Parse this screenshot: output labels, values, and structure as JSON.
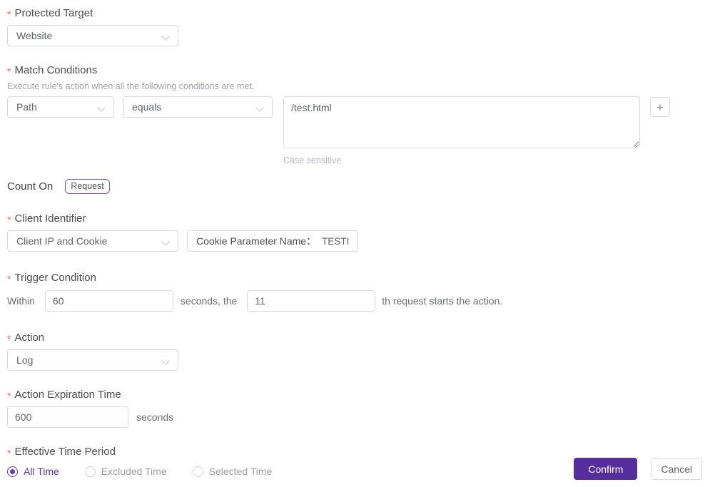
{
  "colors": {
    "accent_purple": "#562d9c",
    "radio_purple": "#6a3ac2",
    "required_red": "#f56c6c"
  },
  "icons": {
    "add_icon": "+",
    "chevron": "chevron-down",
    "required_mark": "*"
  },
  "form": {
    "protected_target": {
      "label": "Protected Target",
      "value": "Website"
    },
    "match_conditions": {
      "label": "Match Conditions",
      "description": "Execute rule's action when all the following conditions are met.",
      "field_value": "Path",
      "operator_value": "equals",
      "pattern_value": "/test.html",
      "hint": "Case sensitive"
    },
    "count_on": {
      "label": "Count On",
      "badge": "Request"
    },
    "client_identifier": {
      "label": "Client Identifier",
      "value": "Client IP and Cookie",
      "cookie_param_label": "Cookie Parameter Name：",
      "cookie_param_value": "TESTI"
    },
    "trigger_condition": {
      "label": "Trigger Condition",
      "prefix": "Within",
      "seconds_value": "60",
      "middle": "seconds, the",
      "count_value": "11",
      "suffix": "th request starts the action."
    },
    "action": {
      "label": "Action",
      "value": "Log"
    },
    "action_expiration": {
      "label": "Action Expiration Time",
      "value": "600",
      "unit": "seconds"
    },
    "effective_time": {
      "label": "Effective Time Period",
      "options": [
        {
          "label": "All Time",
          "selected": true
        },
        {
          "label": "Excluded Time",
          "selected": false
        },
        {
          "label": "Selected Time",
          "selected": false
        }
      ]
    },
    "footer": {
      "confirm": "Confirm",
      "cancel": "Cancel"
    }
  }
}
